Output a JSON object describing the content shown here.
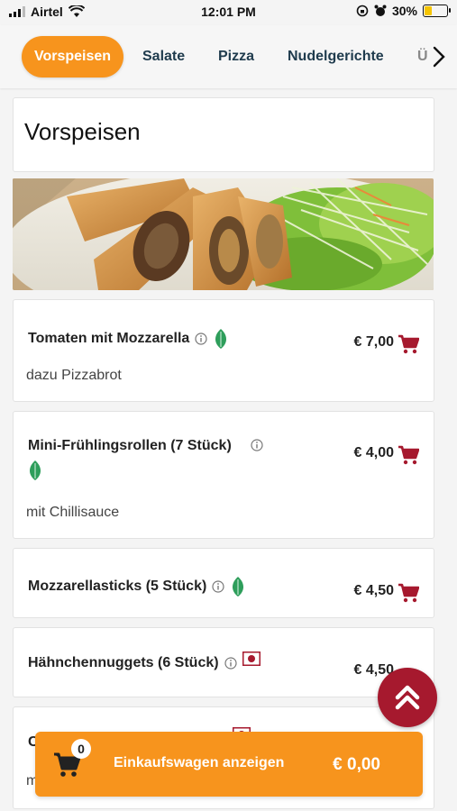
{
  "status_bar": {
    "carrier": "Airtel",
    "time": "12:01 PM",
    "battery": "30%"
  },
  "tabs": [
    {
      "label": "Vorspeisen",
      "active": true
    },
    {
      "label": "Salate",
      "active": false
    },
    {
      "label": "Pizza",
      "active": false
    },
    {
      "label": "Nudelgerichte",
      "active": false
    },
    {
      "label": "Üb",
      "active": false
    }
  ],
  "section": {
    "title": "Vorspeisen"
  },
  "items": [
    {
      "name": "Tomaten mit Mozzarella",
      "description": "dazu Pizzabrot",
      "price": "€ 7,00"
    },
    {
      "name": "Mini-Frühlingsrollen (7 Stück)",
      "description": "mit Chillisauce",
      "price": "€ 4,00"
    },
    {
      "name": "Mozzarellasticks (5 Stück)",
      "description": "",
      "price": "€ 4,50"
    },
    {
      "name": "Hähnchennuggets (6 Stück)",
      "description": "",
      "price": "€ 4,50"
    },
    {
      "name": "C",
      "description": "m",
      "price": ""
    }
  ],
  "cart": {
    "count": "0",
    "label": "Einkaufswagen anzeigen",
    "total": "€ 0,00"
  },
  "colors": {
    "accent": "#f7941d",
    "brand_red": "#a6192e",
    "veg_green": "#2e9e5b"
  },
  "icons": [
    "signal-icon",
    "wifi-icon",
    "alarm-icon",
    "battery-icon",
    "chevron-right-icon",
    "info-icon",
    "leaf-icon",
    "flag-icon",
    "cart-add-icon",
    "double-chevron-up-icon",
    "cart-icon"
  ]
}
